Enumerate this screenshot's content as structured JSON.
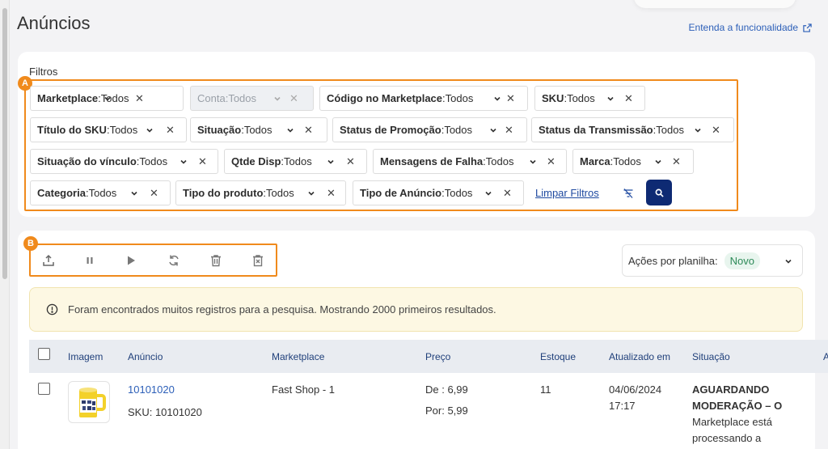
{
  "header": {
    "title": "Anúncios",
    "help_link": "Entenda a funcionalidade"
  },
  "filters": {
    "label": "Filtros",
    "callout": "A",
    "chips": [
      {
        "name": "Marketplace",
        "value": "Todos",
        "disabled": false
      },
      {
        "name": "Conta",
        "value": "Todos",
        "disabled": true
      },
      {
        "name": "Código no Marketplace",
        "value": "Todos",
        "disabled": false
      },
      {
        "name": "SKU",
        "value": "Todos",
        "disabled": false
      },
      {
        "name": "Título do SKU",
        "value": "Todos",
        "disabled": false
      },
      {
        "name": "Situação",
        "value": "Todos",
        "disabled": false
      },
      {
        "name": "Status de Promoção",
        "value": "Todos",
        "disabled": false
      },
      {
        "name": "Status da Transmissão",
        "value": "Todos",
        "disabled": false
      },
      {
        "name": "Situação do vínculo",
        "value": "Todos",
        "disabled": false
      },
      {
        "name": "Qtde Disp",
        "value": "Todos",
        "disabled": false
      },
      {
        "name": "Mensagens de Falha",
        "value": "Todos",
        "disabled": false
      },
      {
        "name": "Marca",
        "value": "Todos",
        "disabled": false
      },
      {
        "name": "Categoria",
        "value": "Todos",
        "disabled": false
      },
      {
        "name": "Tipo do produto",
        "value": "Todos",
        "disabled": false
      },
      {
        "name": "Tipo de Anúncio",
        "value": "Todos",
        "disabled": false
      }
    ],
    "clear_label": "Limpar Filtros"
  },
  "toolbar": {
    "callout": "B",
    "icons": [
      "upload-icon",
      "pause-icon",
      "play-icon",
      "refresh-icon",
      "trash-icon",
      "delete-box-icon"
    ],
    "sheet_actions_label": "Ações por planilha:",
    "sheet_actions_value": "Novo"
  },
  "alert": {
    "message": "Foram encontrados muitos registros para a pesquisa. Mostrando 2000 primeiros resultados."
  },
  "table": {
    "columns": [
      "Imagem",
      "Anúncio",
      "Marketplace",
      "Preço",
      "Estoque",
      "Atualizado em",
      "Situação",
      "A"
    ],
    "rows": [
      {
        "anuncio": "10101020",
        "sku": "SKU: 10101020",
        "marketplace": "Fast Shop - 1",
        "preco_de": "De : 6,99",
        "preco_por": "Por: 5,99",
        "estoque": "11",
        "atualizado_data": "04/06/2024",
        "atualizado_hora": "17:17",
        "situacao": [
          "AGUARDANDO",
          "MODERAÇÃO – O",
          "Marketplace está",
          "processando a"
        ]
      }
    ]
  },
  "colors": {
    "accent": "#f08a1c",
    "primary": "#0e2a73",
    "link": "#2c5fb8"
  }
}
